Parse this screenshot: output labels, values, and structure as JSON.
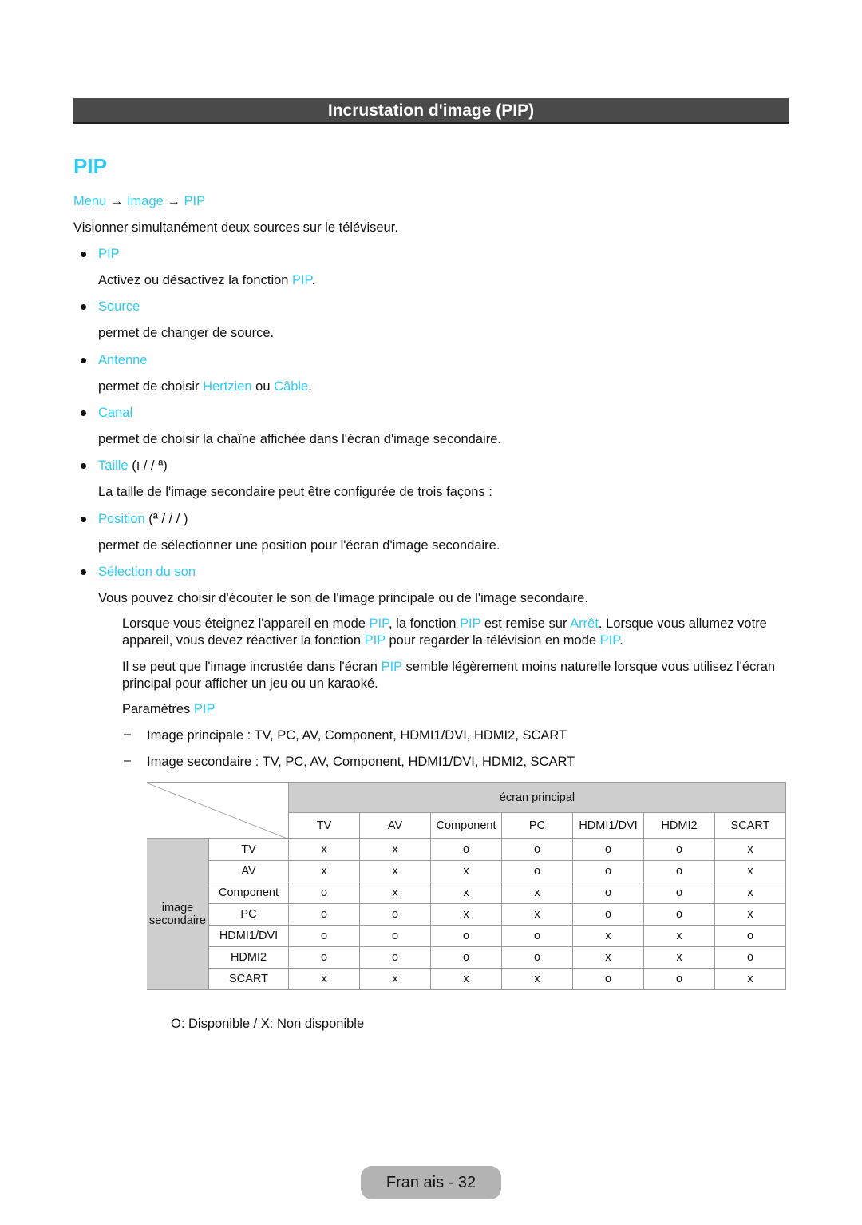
{
  "header": {
    "title": "Incrustation d'image (PIP)"
  },
  "section": {
    "title": "PIP"
  },
  "breadcrumb": [
    {
      "t": "Menu",
      "link": true
    },
    {
      "t": " → "
    },
    {
      "t": "Image",
      "link": true
    },
    {
      "t": " → "
    },
    {
      "t": "PIP",
      "link": true
    }
  ],
  "intro": "Visionner simultanément deux sources sur le téléviseur.",
  "items": [
    {
      "label": [
        {
          "t": "PIP",
          "link": true
        }
      ],
      "desc": [
        {
          "t": "Activez ou désactivez la fonction "
        },
        {
          "t": "PIP",
          "link": true
        },
        {
          "t": "."
        }
      ]
    },
    {
      "label": [
        {
          "t": "Source",
          "link": true
        }
      ],
      "desc": [
        {
          "t": "permet de changer de source."
        }
      ]
    },
    {
      "label": [
        {
          "t": "Antenne",
          "link": true
        }
      ],
      "desc": [
        {
          "t": "permet de choisir "
        },
        {
          "t": "Hertzien",
          "link": true
        },
        {
          "t": " ou "
        },
        {
          "t": "Câble",
          "link": true
        },
        {
          "t": "."
        }
      ]
    },
    {
      "label": [
        {
          "t": "Canal",
          "link": true
        }
      ],
      "desc": [
        {
          "t": "permet de choisir la chaîne affichée dans l'écran d'image secondaire."
        }
      ]
    },
    {
      "label": [
        {
          "t": "Taille",
          "link": true
        },
        {
          "t": " (ı /   / ª)"
        }
      ],
      "desc": [
        {
          "t": "La taille de l'image secondaire peut être configurée de trois façons :"
        }
      ]
    },
    {
      "label": [
        {
          "t": "Position",
          "link": true
        },
        {
          "t": " (ª /   /   /  )"
        }
      ],
      "desc": [
        {
          "t": "permet de sélectionner une position pour l'écran d'image secondaire."
        }
      ]
    },
    {
      "label": [
        {
          "t": "Sélection du son",
          "link": true
        }
      ],
      "desc": [
        {
          "t": "Vous pouvez choisir d'écouter le son de l'image principale ou de l'image secondaire."
        }
      ]
    }
  ],
  "notes": [
    [
      {
        "t": "Lorsque vous éteignez l'appareil en mode "
      },
      {
        "t": "PIP",
        "link": true
      },
      {
        "t": ", la fonction "
      },
      {
        "t": "PIP",
        "link": true
      },
      {
        "t": " est remise sur "
      },
      {
        "t": "Arrêt",
        "link": true
      },
      {
        "t": ". Lorsque vous allumez votre appareil, vous devez réactiver la fonction "
      },
      {
        "t": "PIP",
        "link": true
      },
      {
        "t": " pour regarder la télévision en mode "
      },
      {
        "t": "PIP",
        "link": true
      },
      {
        "t": "."
      }
    ],
    [
      {
        "t": "Il se peut que l'image incrustée dans l'écran "
      },
      {
        "t": "PIP",
        "link": true
      },
      {
        "t": " semble légèrement moins naturelle lorsque vous utilisez l'écran principal pour afficher un jeu ou un karaoké."
      }
    ],
    [
      {
        "t": "Paramètres "
      },
      {
        "t": "PIP",
        "link": true
      }
    ]
  ],
  "params": [
    "Image principale : TV, PC, AV, Component, HDMI1/DVI, HDMI2, SCART",
    "Image secondaire : TV, PC, AV, Component, HDMI1/DVI, HDMI2, SCART"
  ],
  "table": {
    "main_header": "écran principal",
    "side_header": "image secondaire",
    "columns": [
      "TV",
      "AV",
      "Component",
      "PC",
      "HDMI1/DVI",
      "HDMI2",
      "SCART"
    ],
    "rows": [
      {
        "label": "TV",
        "cells": [
          "x",
          "x",
          "o",
          "o",
          "o",
          "o",
          "x"
        ]
      },
      {
        "label": "AV",
        "cells": [
          "x",
          "x",
          "x",
          "o",
          "o",
          "o",
          "x"
        ]
      },
      {
        "label": "Component",
        "cells": [
          "o",
          "x",
          "x",
          "x",
          "o",
          "o",
          "x"
        ]
      },
      {
        "label": "PC",
        "cells": [
          "o",
          "o",
          "x",
          "x",
          "o",
          "o",
          "x"
        ]
      },
      {
        "label": "HDMI1/DVI",
        "cells": [
          "o",
          "o",
          "o",
          "o",
          "x",
          "x",
          "o"
        ]
      },
      {
        "label": "HDMI2",
        "cells": [
          "o",
          "o",
          "o",
          "o",
          "x",
          "x",
          "o"
        ]
      },
      {
        "label": "SCART",
        "cells": [
          "x",
          "x",
          "x",
          "x",
          "o",
          "o",
          "x"
        ]
      }
    ]
  },
  "legend": "O: Disponible / X: Non disponible",
  "footer": "Fran ais - 32",
  "colors": {
    "link": "#2ecbf4",
    "titlebar": "#4a4a4a",
    "table_header": "#cfcfcf"
  }
}
